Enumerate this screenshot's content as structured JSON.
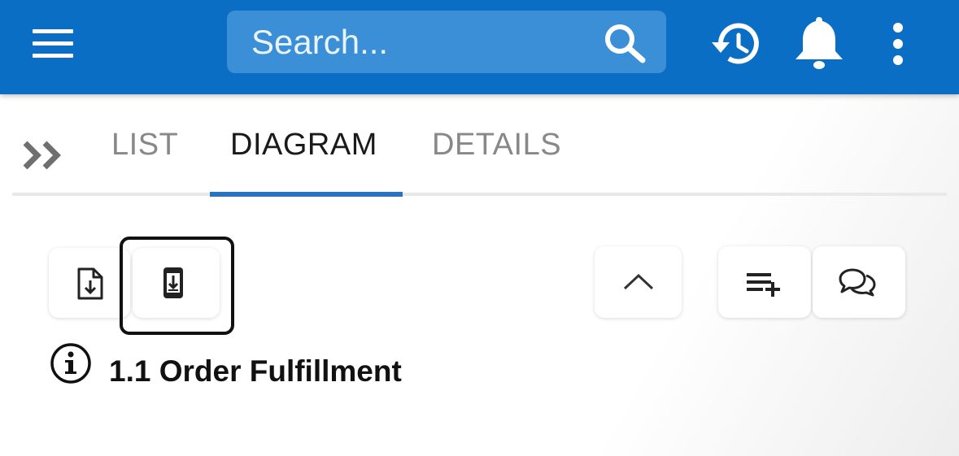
{
  "header": {
    "search_placeholder": "Search...",
    "menu_icon": "hamburger-menu-icon",
    "search_icon": "search-icon",
    "history_icon": "history-icon",
    "notifications_icon": "bell-icon",
    "more_icon": "more-vertical-icon",
    "bar_color": "#0b6ec5"
  },
  "tabs": {
    "expand_icon": "double-chevron-right-icon",
    "items": [
      {
        "label": "LIST",
        "active": false
      },
      {
        "label": "DIAGRAM",
        "active": true
      },
      {
        "label": "DETAILS",
        "active": false
      }
    ],
    "indicator_color": "#2a72c2"
  },
  "toolbar": {
    "left_buttons": [
      {
        "icon": "file-download-icon"
      },
      {
        "icon": "mobile-download-icon",
        "focused": true
      }
    ],
    "right_buttons": [
      {
        "icon": "chevron-up-icon"
      },
      {
        "icon": "playlist-add-icon"
      },
      {
        "icon": "comments-icon"
      }
    ]
  },
  "diagram": {
    "info_icon": "info-icon",
    "title": "1.1 Order Fulfillment"
  }
}
